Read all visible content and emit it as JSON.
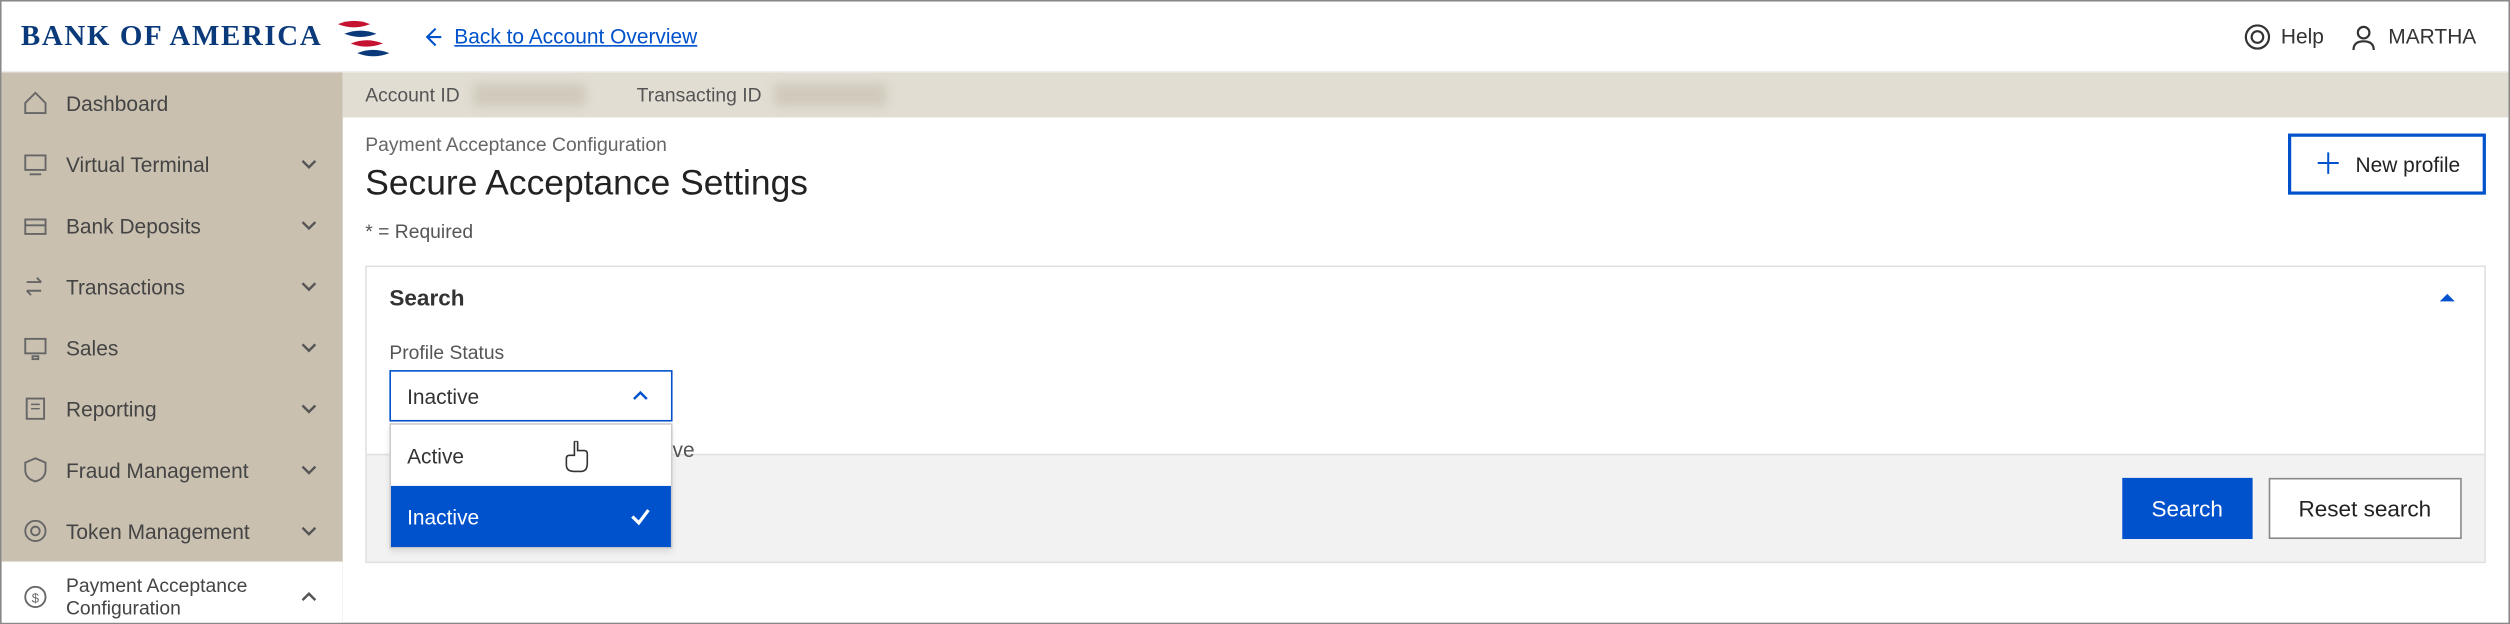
{
  "header": {
    "logo_text": "BANK OF AMERICA",
    "back_link": "Back to Account Overview",
    "help_label": "Help",
    "user_name": "MARTHA"
  },
  "sidebar": {
    "items": [
      {
        "label": "Dashboard",
        "icon": "home-icon",
        "expandable": false
      },
      {
        "label": "Virtual Terminal",
        "icon": "terminal-icon",
        "expandable": true
      },
      {
        "label": "Bank Deposits",
        "icon": "deposits-icon",
        "expandable": true
      },
      {
        "label": "Transactions",
        "icon": "transactions-icon",
        "expandable": true
      },
      {
        "label": "Sales",
        "icon": "sales-icon",
        "expandable": true
      },
      {
        "label": "Reporting",
        "icon": "reporting-icon",
        "expandable": true
      },
      {
        "label": "Fraud Management",
        "icon": "shield-icon",
        "expandable": true
      },
      {
        "label": "Token Management",
        "icon": "token-icon",
        "expandable": true
      },
      {
        "label_line1": "Payment Acceptance",
        "label_line2": "Configuration",
        "icon": "config-icon",
        "expandable": true,
        "active": true
      }
    ]
  },
  "idbar": {
    "account_id_label": "Account ID",
    "transacting_id_label": "Transacting ID"
  },
  "page": {
    "breadcrumb": "Payment Acceptance Configuration",
    "title": "Secure Acceptance Settings",
    "required_note": "* = Required",
    "new_profile_label": "New profile"
  },
  "search": {
    "heading": "Search",
    "field_label": "Profile Status",
    "selected_value": "Inactive",
    "options": [
      {
        "label": "Active",
        "selected": false
      },
      {
        "label": "Inactive",
        "selected": true
      }
    ],
    "truncated_hint": "ve",
    "search_button": "Search",
    "reset_button": "Reset search"
  },
  "colors": {
    "primary": "#0052cc",
    "sidebar_bg": "#c9c0b0"
  }
}
